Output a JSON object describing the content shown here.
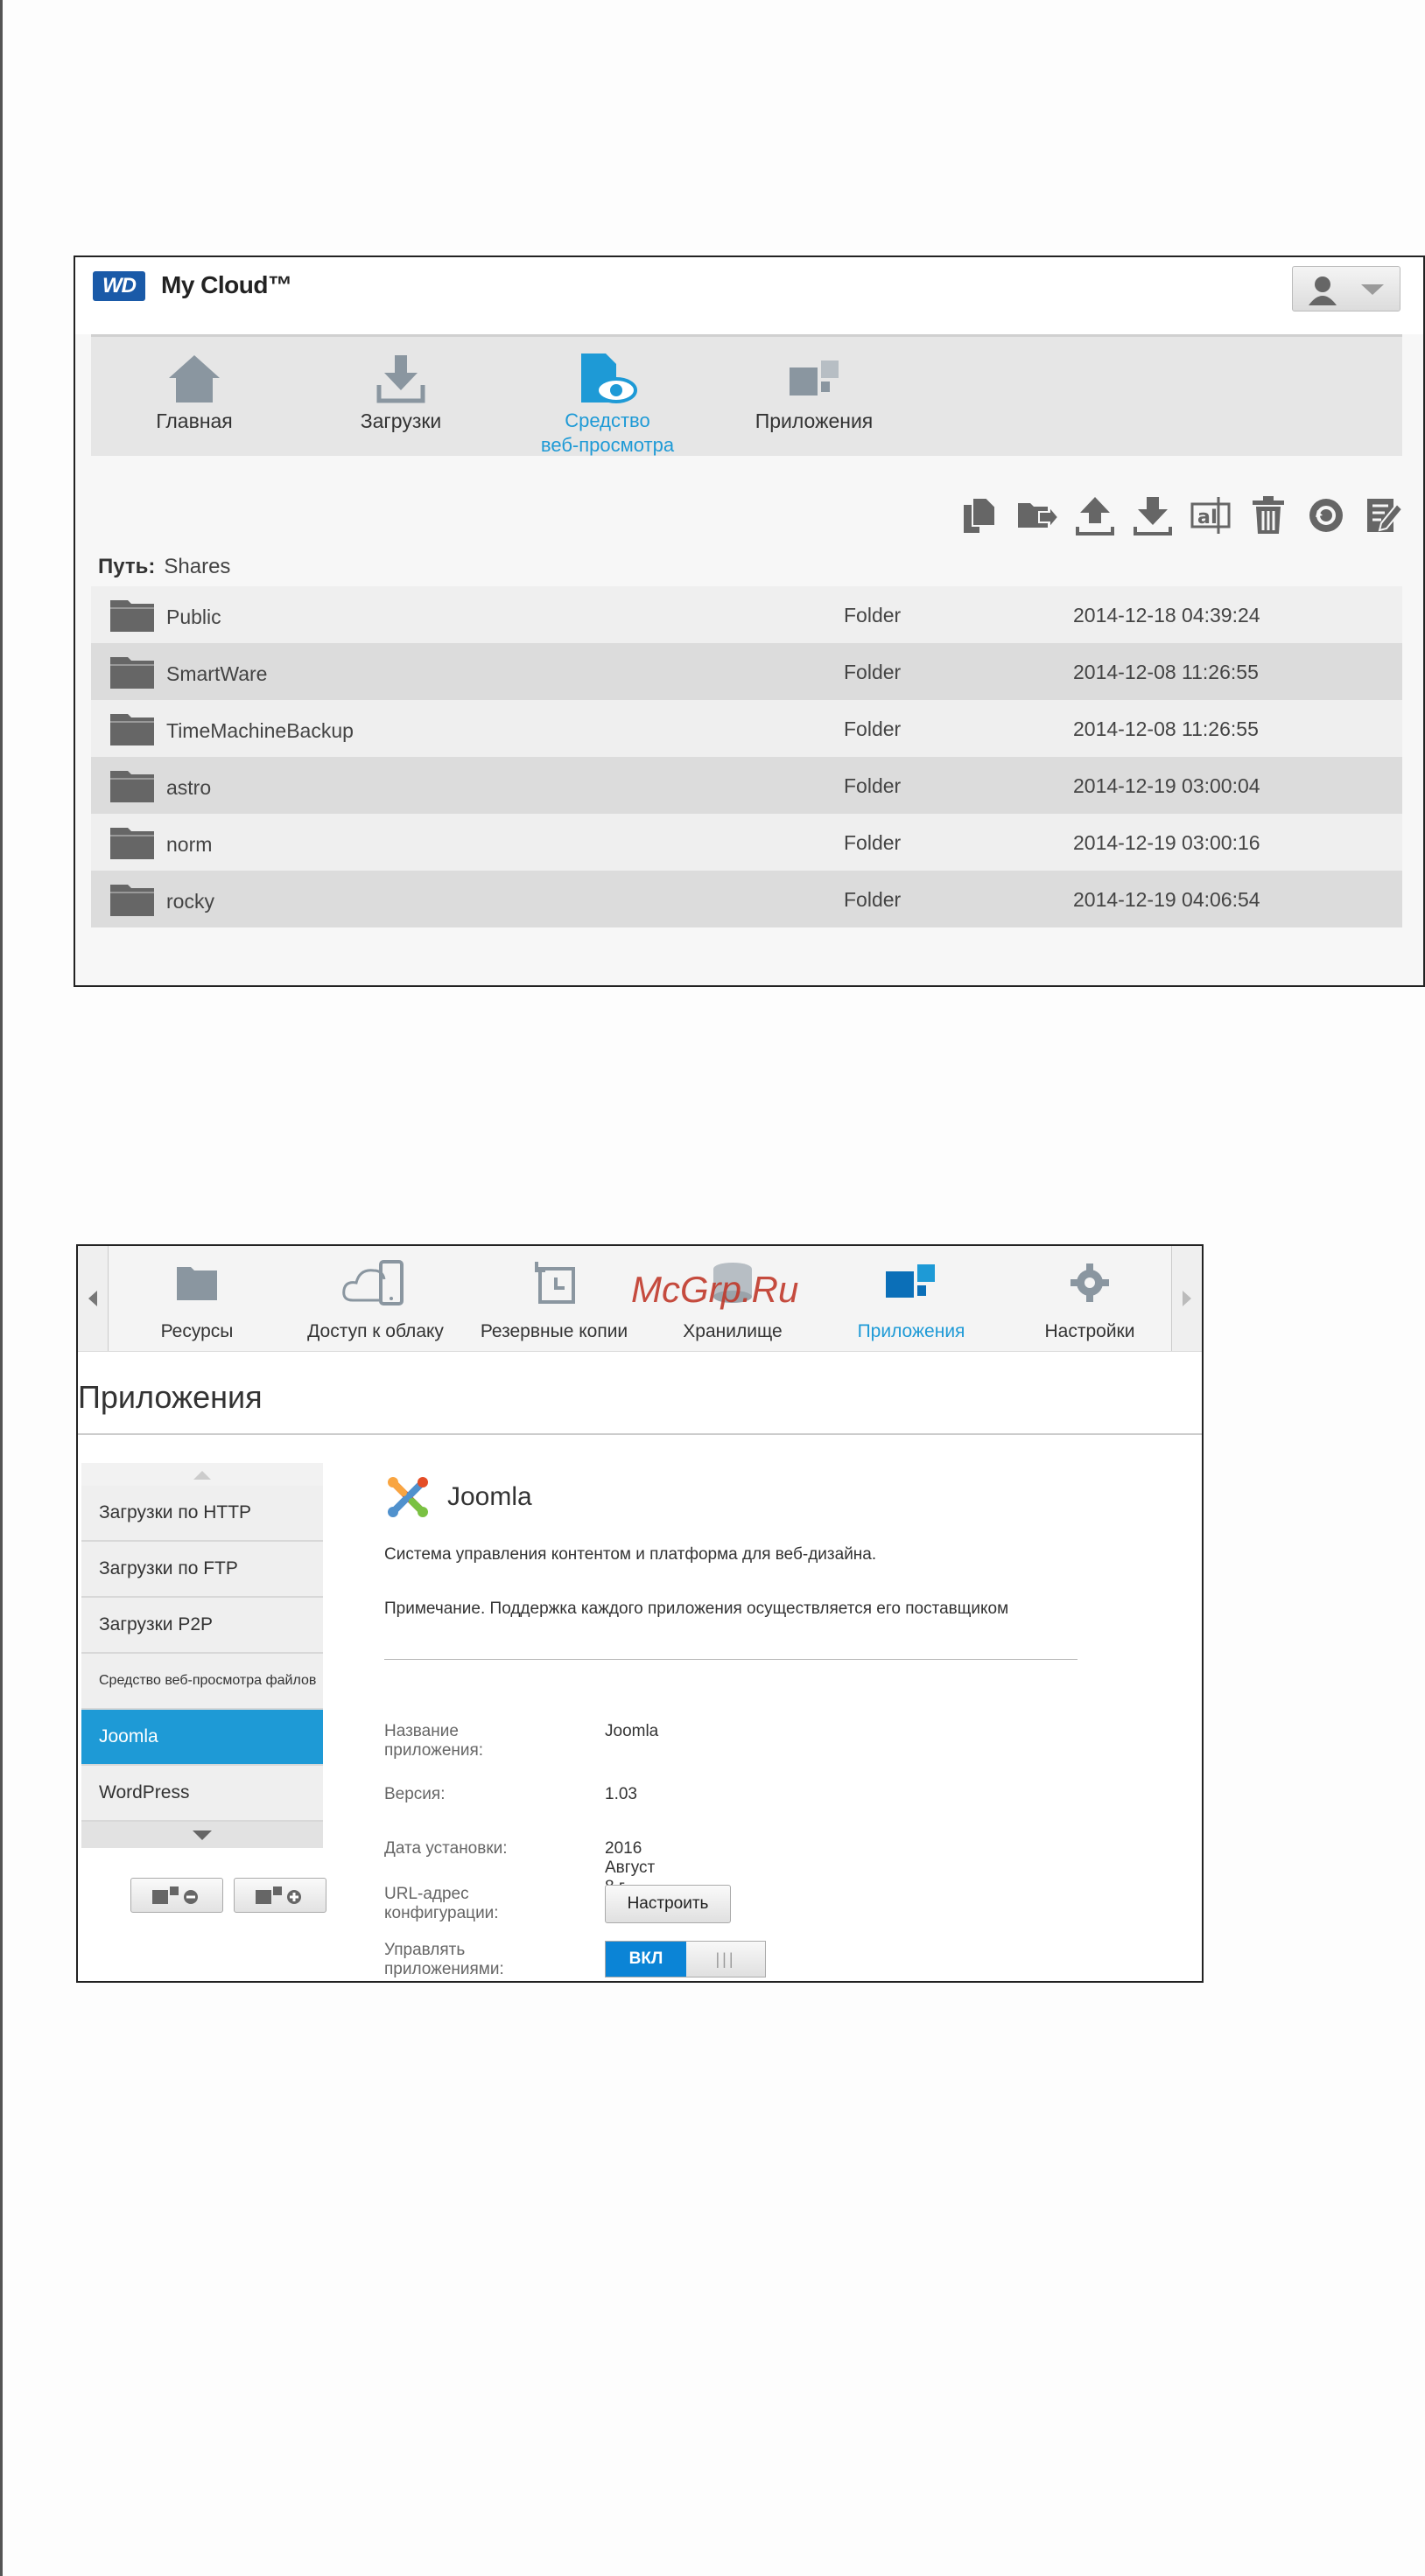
{
  "screen1": {
    "brand": "My Cloud™",
    "logo_text": "WD",
    "nav": [
      {
        "label": "Главная",
        "icon": "home-icon"
      },
      {
        "label": "Загрузки",
        "icon": "download-icon"
      },
      {
        "label": "Средство\nвеб-просмотра",
        "icon": "file-viewer-icon",
        "active": true
      },
      {
        "label": "Приложения",
        "icon": "apps-icon"
      }
    ],
    "toolbar": [
      "copy-icon",
      "move-icon",
      "upload-icon",
      "download-icon",
      "rename-icon",
      "delete-icon",
      "refresh-icon",
      "edit-icon"
    ],
    "path_label": "Путь:",
    "path_value": "Shares",
    "files": [
      {
        "name": "Public",
        "type": "Folder",
        "date": "2014-12-18 04:39:24"
      },
      {
        "name": "SmartWare",
        "type": "Folder",
        "date": "2014-12-08 11:26:55"
      },
      {
        "name": "TimeMachineBackup",
        "type": "Folder",
        "date": "2014-12-08 11:26:55"
      },
      {
        "name": "astro",
        "type": "Folder",
        "date": "2014-12-19 03:00:04"
      },
      {
        "name": "norm",
        "type": "Folder",
        "date": "2014-12-19 03:00:16"
      },
      {
        "name": "rocky",
        "type": "Folder",
        "date": "2014-12-19 04:06:54"
      }
    ],
    "accent": "#1e9ad6"
  },
  "screen2": {
    "nav": [
      {
        "label": "Ресурсы",
        "icon": "folder-icon"
      },
      {
        "label": "Доступ к облаку",
        "icon": "cloud-device-icon"
      },
      {
        "label": "Резервные копии",
        "icon": "backup-icon"
      },
      {
        "label": "Хранилище",
        "icon": "storage-icon"
      },
      {
        "label": "Приложения",
        "icon": "apps-icon",
        "active": true
      },
      {
        "label": "Настройки",
        "icon": "gear-icon"
      }
    ],
    "watermark": "McGrp.Ru",
    "page_title": "Приложения",
    "sidebar": [
      {
        "label": "Загрузки по HTTP"
      },
      {
        "label": "Загрузки по FTP"
      },
      {
        "label": "Загрузки P2P"
      },
      {
        "label": "Средство веб-просмотра файлов"
      },
      {
        "label": "Joomla",
        "active": true
      },
      {
        "label": "WordPress"
      }
    ],
    "app": {
      "name": "Joomla",
      "description": "Система управления контентом и платформа для веб-дизайна.",
      "note": "Примечание. Поддержка каждого приложения осуществляется его поставщиком",
      "fields": {
        "app_name_label": "Название приложения:",
        "app_name_value": "Joomla",
        "version_label": "Версия:",
        "version_value": "1.03",
        "install_date_label": "Дата установки:",
        "install_date_value": "2016 Август 8 г. 9:12:11",
        "config_url_label": "URL-адрес конфигурации:",
        "config_button": "Настроить",
        "manage_label": "Управлять приложениями:",
        "toggle_on": "ВКЛ",
        "toggle_grip": "|||"
      }
    },
    "accent": "#1e9ad6"
  }
}
